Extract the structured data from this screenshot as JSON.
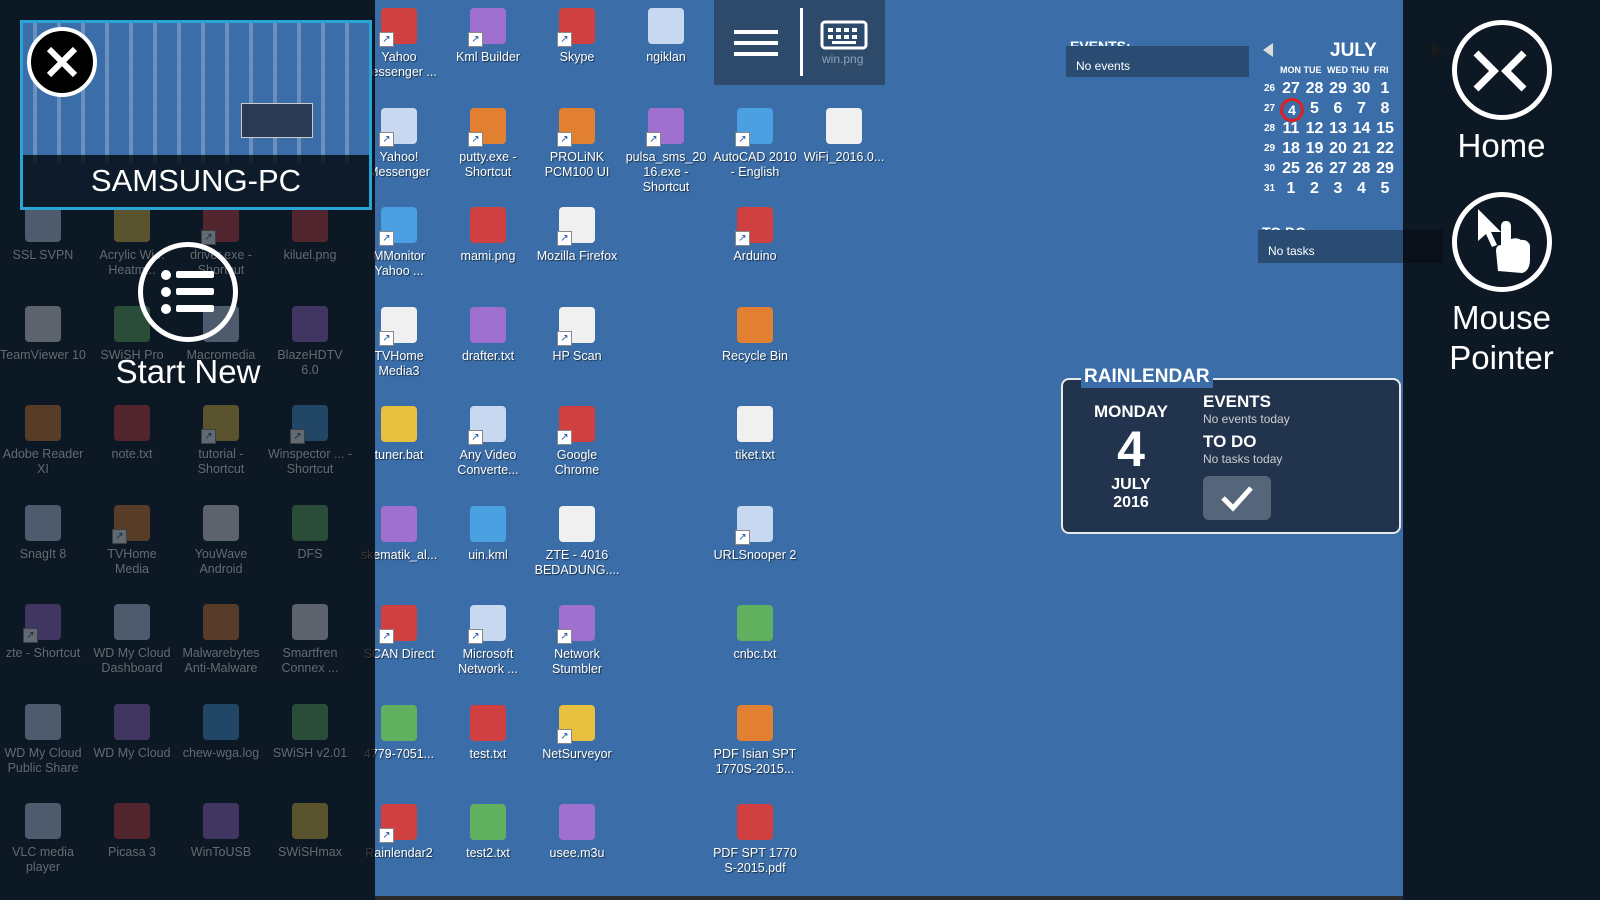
{
  "thumbnail": {
    "label": "SAMSUNG-PC"
  },
  "left_panel": {
    "start_new_label": "Start New"
  },
  "right_panel": {
    "home_label": "Home",
    "mouse_label_line1": "Mouse",
    "mouse_label_line2": "Pointer"
  },
  "toolbar": {
    "hidden_icon_label": "win.png"
  },
  "icons": {
    "c1": [
      "Yahoo Messenger ...",
      "Yahoo! Messenger",
      "MMonitor Yahoo ...",
      "TVHome Media3",
      "tuner.bat",
      "skematik_al...",
      "SCAN Direct",
      "4779-7051...",
      "Rainlendar2"
    ],
    "c2": [
      "Kml Builder",
      "putty.exe - Shortcut",
      "mami.png",
      "drafter.txt",
      "Any Video Converte...",
      "uin.kml",
      "Microsoft Network ...",
      "test.txt",
      "test2.txt"
    ],
    "c3": [
      "Skype",
      "PROLiNK PCM100 UI",
      "Mozilla Firefox",
      "HP Scan",
      "Google Chrome",
      "ZTE - 4016 BEDADUNG....",
      "Network Stumbler",
      "NetSurveyor",
      "usee.m3u"
    ],
    "c4": [
      "ngiklan",
      "pulsa_sms_2016.exe - Shortcut"
    ],
    "c5": [
      "AutoCAD 2010 - English",
      "Arduino",
      "Recycle Bin",
      "tiket.txt",
      "URLSnooper 2",
      "cnbc.txt",
      "PDF Isian SPT 1770S-2015...",
      "PDF SPT 1770 S-2015.pdf"
    ],
    "c6": [
      "WiFi_2016.0..."
    ]
  },
  "dim_icons": {
    "c1": [
      "SSL SVPN",
      "TeamViewer 10",
      "Adobe Reader XI",
      "SnagIt 8",
      "zte - Shortcut",
      "WD My Cloud Public Share",
      "VLC media player"
    ],
    "c2": [
      "Acrylic Wi... Heatm...",
      "SWiSH Pro",
      "note.txt",
      "TVHome Media",
      "WD My Cloud Dashboard",
      "WD My Cloud",
      "Picasa 3"
    ],
    "c3": [
      "driver.exe - Shortcut",
      "Macromedia",
      "tutorial - Shortcut",
      "YouWave Android",
      "Malwarebytes Anti-Malware",
      "chew-wga.log",
      "WinToUSB"
    ],
    "c4": [
      "kiluel.png",
      "BlazeHDTV 6.0",
      "Winspector ... - Shortcut",
      "DFS",
      "Smartfren Connex ...",
      "SWiSH v2.01",
      "SWiSHmax"
    ]
  },
  "calendar": {
    "events_heading": "EVENTS:",
    "events_text": "No events",
    "month": "JULY",
    "weekdays": [
      "MON",
      "TUE",
      "WED",
      "THU",
      "FRI"
    ],
    "weeks": [
      {
        "wk": "26",
        "days": [
          "27",
          "28",
          "29",
          "30",
          "1"
        ]
      },
      {
        "wk": "27",
        "days": [
          "4",
          "5",
          "6",
          "7",
          "8"
        ]
      },
      {
        "wk": "28",
        "days": [
          "11",
          "12",
          "13",
          "14",
          "15"
        ]
      },
      {
        "wk": "29",
        "days": [
          "18",
          "19",
          "20",
          "21",
          "22"
        ]
      },
      {
        "wk": "30",
        "days": [
          "25",
          "26",
          "27",
          "28",
          "29"
        ]
      },
      {
        "wk": "31",
        "days": [
          "1",
          "2",
          "3",
          "4",
          "5"
        ]
      }
    ],
    "today": "4",
    "todo_heading": "TO DO:",
    "todo_text": "No tasks"
  },
  "rainlendar": {
    "title": "RAINLENDAR",
    "weekday": "MONDAY",
    "day": "4",
    "month": "JULY",
    "year": "2016",
    "events_heading": "EVENTS",
    "events_text": "No events today",
    "todo_heading": "TO DO",
    "todo_text": "No tasks today"
  },
  "colors": {
    "desktop": "#3b6ea8",
    "thumb_border": "#2aa3d6",
    "today_circle": "#e02020"
  }
}
